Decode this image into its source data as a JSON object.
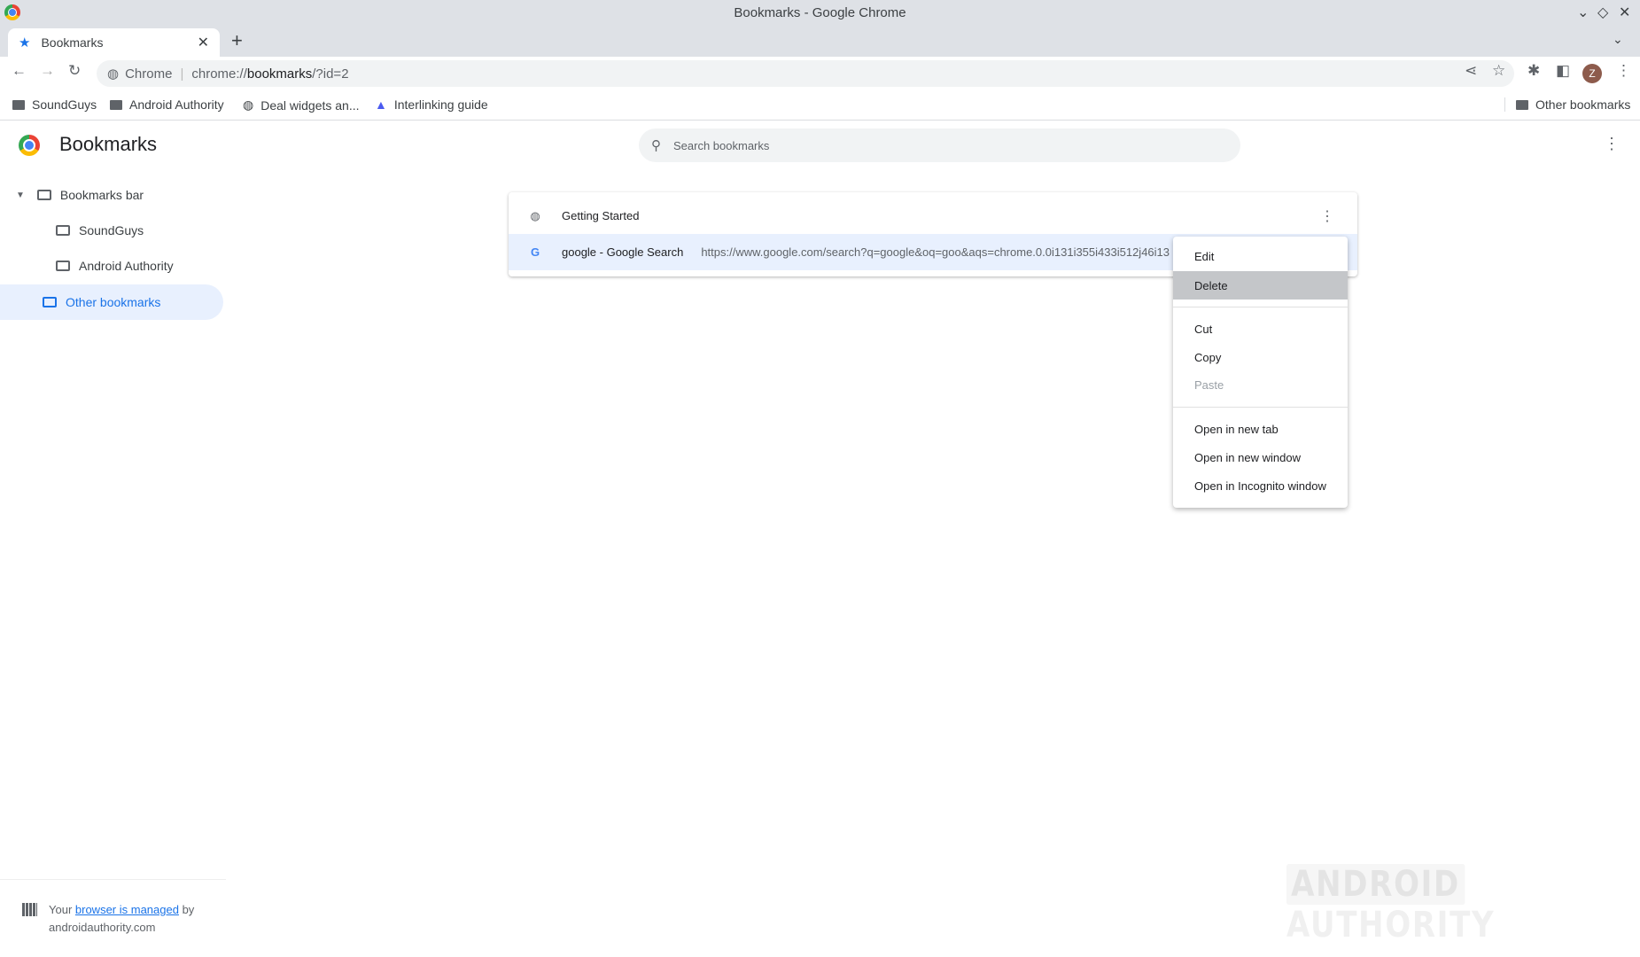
{
  "window": {
    "title": "Bookmarks - Google Chrome"
  },
  "tab": {
    "label": "Bookmarks"
  },
  "omnibox": {
    "chip": "Chrome",
    "url_prefix": "chrome://",
    "url_host": "bookmarks",
    "url_suffix": "/?id=2"
  },
  "profile": {
    "initial": "Z",
    "color": "#8d5b4c"
  },
  "bookmarks_bar": {
    "items": [
      {
        "label": "SoundGuys"
      },
      {
        "label": "Android Authority"
      },
      {
        "label": "Deal widgets an..."
      },
      {
        "label": "Interlinking guide"
      }
    ],
    "other": "Other bookmarks"
  },
  "page": {
    "title": "Bookmarks",
    "search_placeholder": "Search bookmarks"
  },
  "sidebar": {
    "items": [
      {
        "label": "Bookmarks bar"
      },
      {
        "label": "SoundGuys"
      },
      {
        "label": "Android Authority"
      },
      {
        "label": "Other bookmarks"
      }
    ],
    "footer": {
      "prefix": "Your ",
      "link": "browser is managed",
      "suffix": " by",
      "domain": "androidauthority.com"
    }
  },
  "list": [
    {
      "title": "Getting Started"
    },
    {
      "title": "google - Google Search",
      "url": "https://www.google.com/search?q=google&oq=goo&aqs=chrome.0.0i131i355i433i512j46i13"
    }
  ],
  "context_menu": {
    "items": [
      "Edit",
      "Delete",
      "Cut",
      "Copy",
      "Paste",
      "Open in new tab",
      "Open in new window",
      "Open in Incognito window"
    ]
  },
  "watermark": {
    "left": "ANDROID",
    "right": "AUTHORITY"
  },
  "colors": {
    "accent": "#1a73e8",
    "selected_bg": "#e8f0fe",
    "menu_highlight": "#c4c6c9"
  }
}
